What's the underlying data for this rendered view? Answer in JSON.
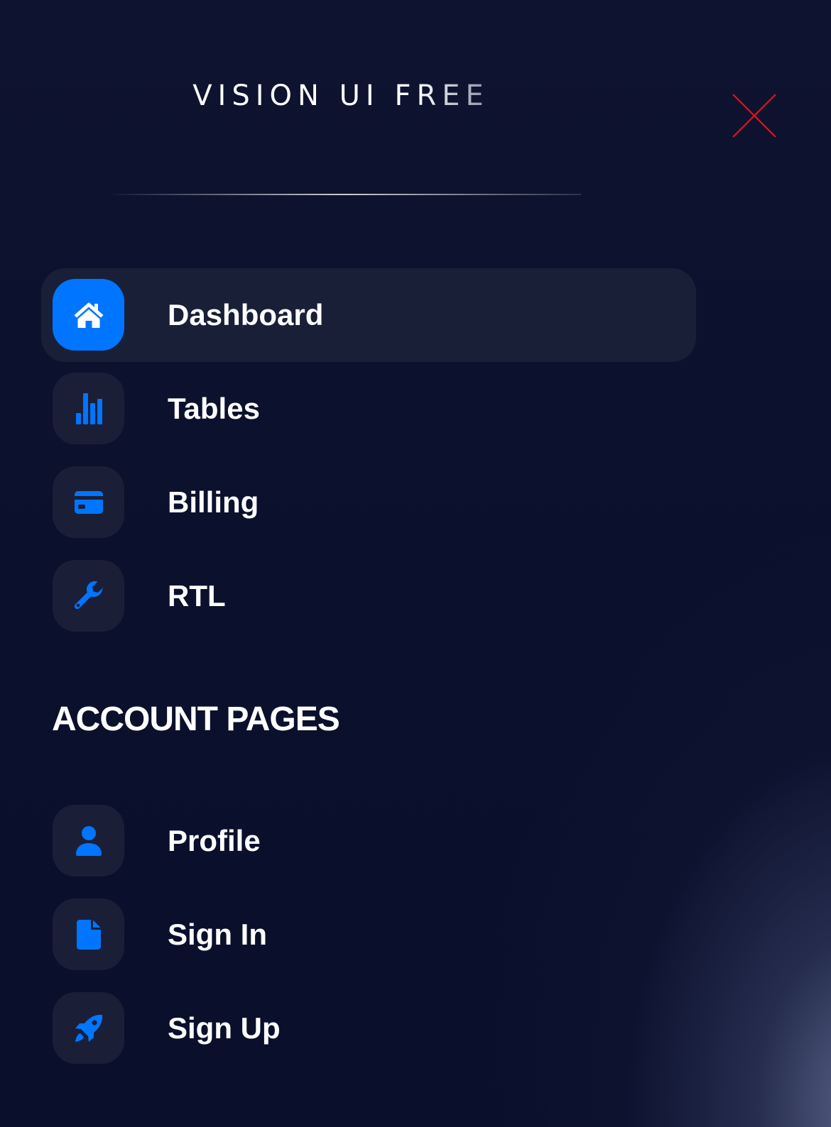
{
  "brand": {
    "title_main": "VISION UI F",
    "title_fade": "REE"
  },
  "close": {
    "icon": "close-icon",
    "color": "#e0141e"
  },
  "colors": {
    "accent": "#0075ff",
    "icon_box": "#1a1f37",
    "background": "#0b112c",
    "text": "#ffffff"
  },
  "nav": {
    "items": [
      {
        "label": "Dashboard",
        "icon": "home-icon",
        "active": true
      },
      {
        "label": "Tables",
        "icon": "bar-chart-icon",
        "active": false
      },
      {
        "label": "Billing",
        "icon": "credit-card-icon",
        "active": false
      },
      {
        "label": "RTL",
        "icon": "wrench-icon",
        "active": false
      }
    ]
  },
  "account": {
    "section_title": "ACCOUNT PAGES",
    "items": [
      {
        "label": "Profile",
        "icon": "user-icon"
      },
      {
        "label": "Sign In",
        "icon": "document-icon"
      },
      {
        "label": "Sign Up",
        "icon": "rocket-icon"
      }
    ]
  }
}
